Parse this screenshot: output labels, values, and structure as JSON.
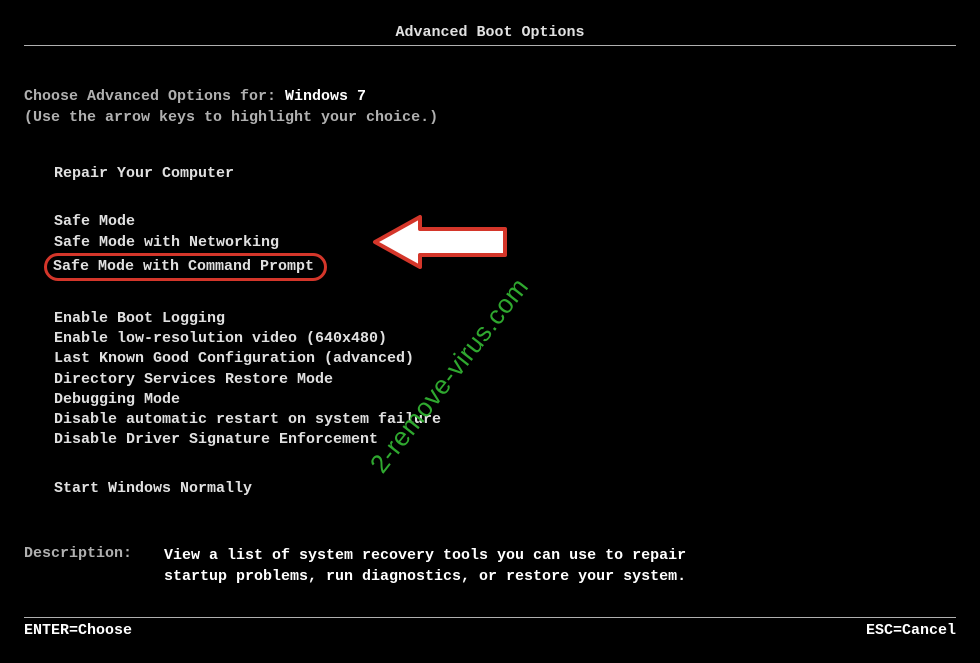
{
  "title": "Advanced Boot Options",
  "instruct_prefix": "Choose Advanced Options for: ",
  "os_name": "Windows 7",
  "instruct_hint": "(Use the arrow keys to highlight your choice.)",
  "options": {
    "repair": "Repair Your Computer",
    "safe": "Safe Mode",
    "safe_net": "Safe Mode with Networking",
    "safe_cmd": "Safe Mode with Command Prompt",
    "boot_log": "Enable Boot Logging",
    "low_res": "Enable low-resolution video (640x480)",
    "last_good": "Last Known Good Configuration (advanced)",
    "dsrm": "Directory Services Restore Mode",
    "debug": "Debugging Mode",
    "no_restart": "Disable automatic restart on system failure",
    "no_sig": "Disable Driver Signature Enforcement",
    "normal": "Start Windows Normally"
  },
  "description_label": "Description:",
  "description_text": "View a list of system recovery tools you can use to repair startup problems, run diagnostics, or restore your system.",
  "footer": {
    "enter": "ENTER=Choose",
    "esc": "ESC=Cancel"
  },
  "watermark": "2-remove-virus.com",
  "annotation_color": "#d4362a"
}
